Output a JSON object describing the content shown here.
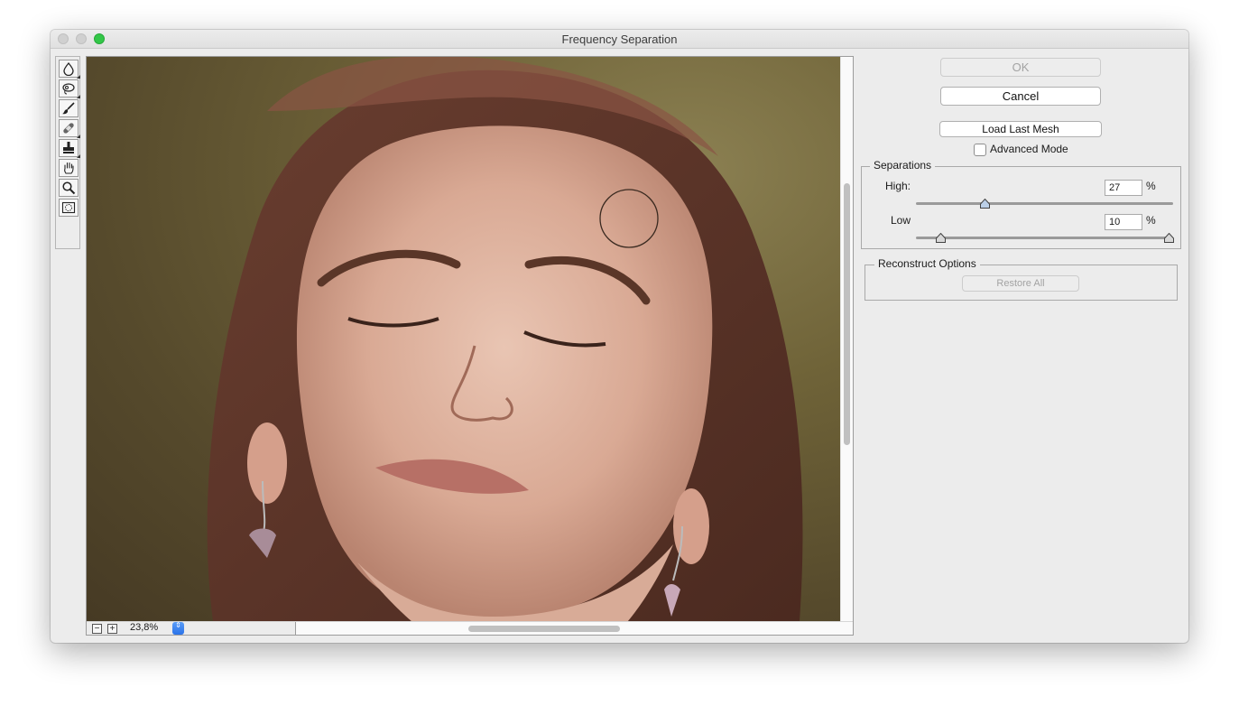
{
  "window": {
    "title": "Frequency Separation"
  },
  "toolbox": {
    "tools": [
      {
        "name": "drop-tool"
      },
      {
        "name": "lasso-tool"
      },
      {
        "name": "brush-tool"
      },
      {
        "name": "healing-tool"
      },
      {
        "name": "stamp-tool"
      },
      {
        "name": "hand-tool"
      },
      {
        "name": "zoom-tool"
      },
      {
        "name": "mask-tool"
      }
    ]
  },
  "canvas": {
    "zoom_value": "23,8%",
    "zoom_out_symbol": "−",
    "zoom_in_symbol": "+",
    "stepper_symbol": "⇕"
  },
  "panel": {
    "ok_label": "OK",
    "cancel_label": "Cancel",
    "load_mesh_label": "Load Last Mesh",
    "advanced_mode_label": "Advanced Mode",
    "advanced_mode_checked": false,
    "separations": {
      "title": "Separations",
      "high_label": "High:",
      "high_value": "27",
      "high_unit": "%",
      "low_label": "Low",
      "low_value": "10",
      "low_unit": "%"
    },
    "reconstruct": {
      "title": "Reconstruct Options",
      "restore_all_label": "Restore All"
    }
  }
}
